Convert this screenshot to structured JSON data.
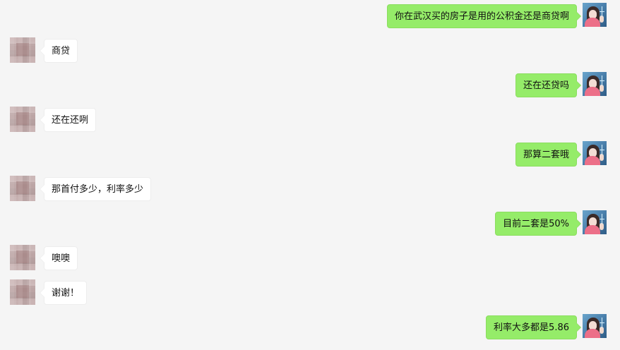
{
  "messages": [
    {
      "side": "right",
      "text": "你在武汉买的房子是用的公积金还是商贷啊"
    },
    {
      "side": "left",
      "text": "商贷"
    },
    {
      "side": "right",
      "text": "还在还贷吗"
    },
    {
      "side": "left",
      "text": "还在还咧"
    },
    {
      "side": "right",
      "text": "那算二套哦"
    },
    {
      "side": "left",
      "text": "那首付多少，利率多少"
    },
    {
      "side": "right",
      "text": "目前二套是50%"
    },
    {
      "side": "left",
      "text": "噢噢"
    },
    {
      "side": "left",
      "text": "谢谢！"
    },
    {
      "side": "right",
      "text": "利率大多都是5.86"
    }
  ],
  "colors": {
    "background": "#f5f5f5",
    "outgoing_bubble": "#95ec69",
    "incoming_bubble": "#ffffff",
    "text": "#111111"
  },
  "icons": {
    "contact_avatar": "blurred-avatar-icon",
    "user_avatar": "girl-avatar-icon"
  }
}
